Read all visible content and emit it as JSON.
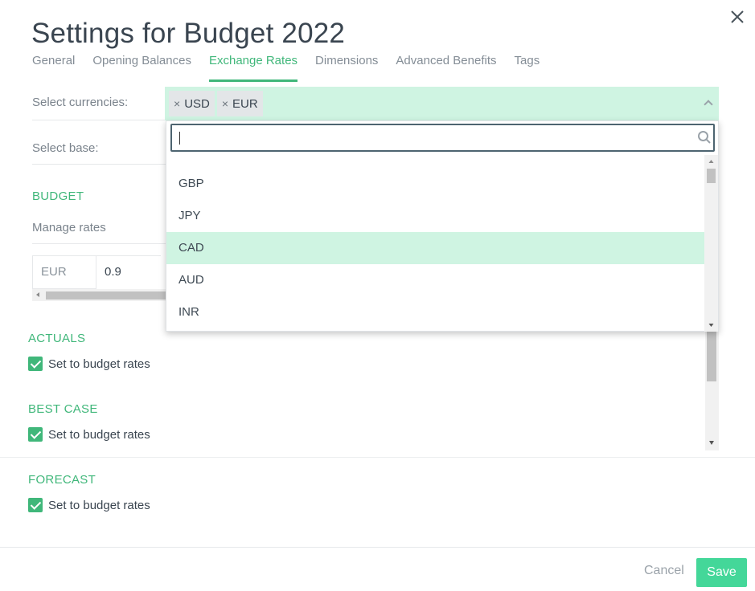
{
  "dialog": {
    "title": "Settings for Budget 2022"
  },
  "tabs": [
    {
      "label": "General",
      "active": false
    },
    {
      "label": "Opening Balances",
      "active": false
    },
    {
      "label": "Exchange Rates",
      "active": true
    },
    {
      "label": "Dimensions",
      "active": false
    },
    {
      "label": "Advanced Benefits",
      "active": false
    },
    {
      "label": "Tags",
      "active": false
    }
  ],
  "form": {
    "currencies_label": "Select currencies:",
    "selected_currencies": [
      "USD",
      "EUR"
    ],
    "chip_remove_glyph": "×",
    "base_label": "Select base:"
  },
  "dropdown": {
    "search_value": "",
    "options": [
      "GBP",
      "JPY",
      "CAD",
      "AUD",
      "INR"
    ],
    "highlighted": "CAD"
  },
  "budget": {
    "heading": "BUDGET",
    "manage_label": "Manage rates",
    "rate_currency": "EUR",
    "rate_value": "0.9"
  },
  "sections": [
    {
      "heading": "ACTUALS",
      "checkbox_label": "Set to budget rates",
      "checked": true
    },
    {
      "heading": "BEST CASE",
      "checkbox_label": "Set to budget rates",
      "checked": true
    },
    {
      "heading": "FORECAST",
      "checkbox_label": "Set to budget rates",
      "checked": true
    }
  ],
  "footer": {
    "cancel_label": "Cancel",
    "save_label": "Save"
  },
  "colors": {
    "accent": "#40b77a",
    "selection_bg": "#cff4e2",
    "save_button": "#44d799"
  },
  "icons": [
    "close-icon",
    "search-icon",
    "chevron-up-icon",
    "checkmark-icon"
  ]
}
